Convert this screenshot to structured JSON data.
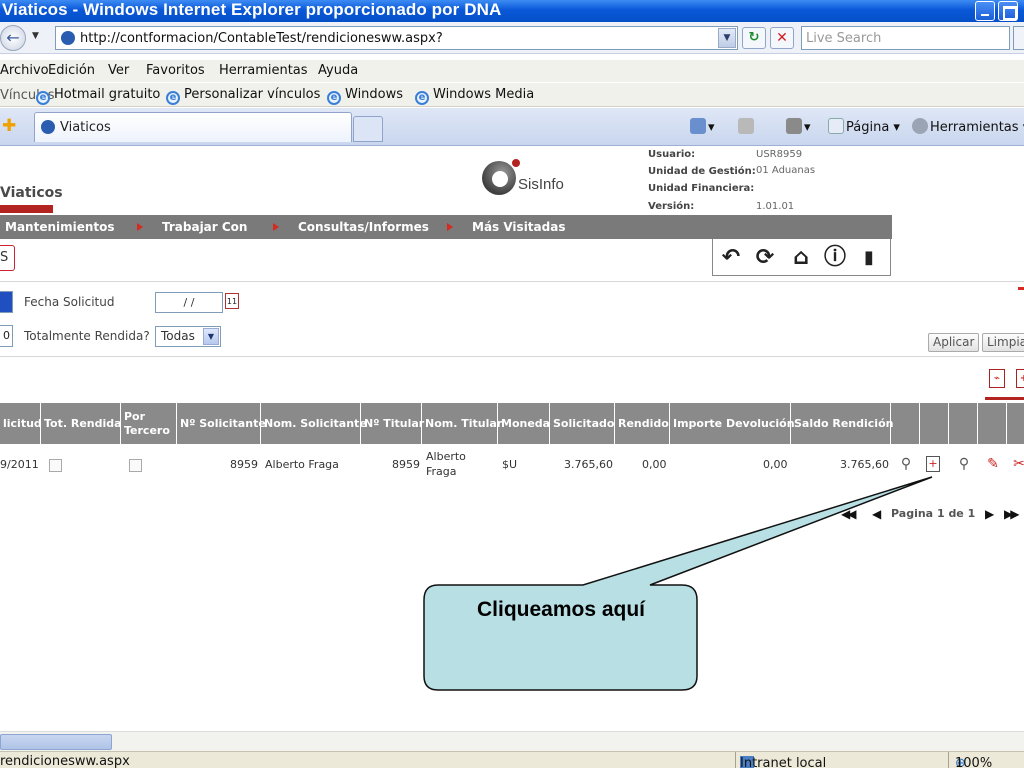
{
  "window": {
    "title": "Viaticos - Windows Internet Explorer proporcionado por DNA"
  },
  "address": {
    "url": "http://contformacion/ContableTest/rendicionesww.aspx?",
    "search_placeholder": "Live Search"
  },
  "menu": [
    "Archivo",
    "Edición",
    "Ver",
    "Favoritos",
    "Herramientas",
    "Ayuda"
  ],
  "links": {
    "label": "Vínculos",
    "items": [
      "Hotmail gratuito",
      "Personalizar vínculos",
      "Windows",
      "Windows Media"
    ]
  },
  "tab": {
    "title": "Viaticos"
  },
  "toolbar": {
    "page": "Página",
    "tools": "Herramientas"
  },
  "app": {
    "title": "Viaticos",
    "logo_text": "SisInfo",
    "info": [
      {
        "label": "Usuario:",
        "value": "USR8959"
      },
      {
        "label": "Unidad de Gestión:",
        "value": "01 Aduanas"
      },
      {
        "label": "Unidad Financiera:",
        "value": ""
      },
      {
        "label": "Versión:",
        "value": "1.01.01"
      }
    ],
    "nav": [
      "Mantenimientos",
      "Trabajar Con",
      "Consultas/Informes",
      "Más Visitadas"
    ],
    "side_tab": "S"
  },
  "filters": {
    "fecha_label": "Fecha Solicitud",
    "fecha_value": " / /",
    "rendida_label": "Totalmente Rendida?",
    "rendida_value": "Todas",
    "rendida_edge": "0",
    "apply": "Aplicar",
    "clear": "Limpiar"
  },
  "table": {
    "headers": [
      "licitud",
      "Tot. Rendida",
      "Por Tercero",
      "Nº Solicitante",
      "Nom. Solicitante",
      "Nº Titular",
      "Nom. Titular",
      "Moneda",
      "Solicitado",
      "Rendido",
      "Importe Devolución",
      "Saldo Rendición"
    ],
    "row": {
      "fecha": "9/2011",
      "n_solicitante": "8959",
      "nom_solicitante": "Alberto Fraga",
      "n_titular": "8959",
      "nom_titular": "Alberto Fraga",
      "moneda": "$U",
      "solicitado": "3.765,60",
      "rendido": "0,00",
      "importe_devolucion": "0,00",
      "saldo_rendicion": "3.765,60"
    },
    "pager": {
      "label": "Pagina",
      "current": "1",
      "of": "de",
      "total": "1"
    }
  },
  "callout": {
    "text": "Cliqueamos aquí"
  },
  "statusbar": {
    "url": "rendicionesww.aspx",
    "zone": "Intranet local",
    "zoom": "100%"
  },
  "colors": {
    "accent": "#b3231f",
    "nav_bg": "#7a7a7a",
    "callout_fill": "#b8e0e4"
  }
}
